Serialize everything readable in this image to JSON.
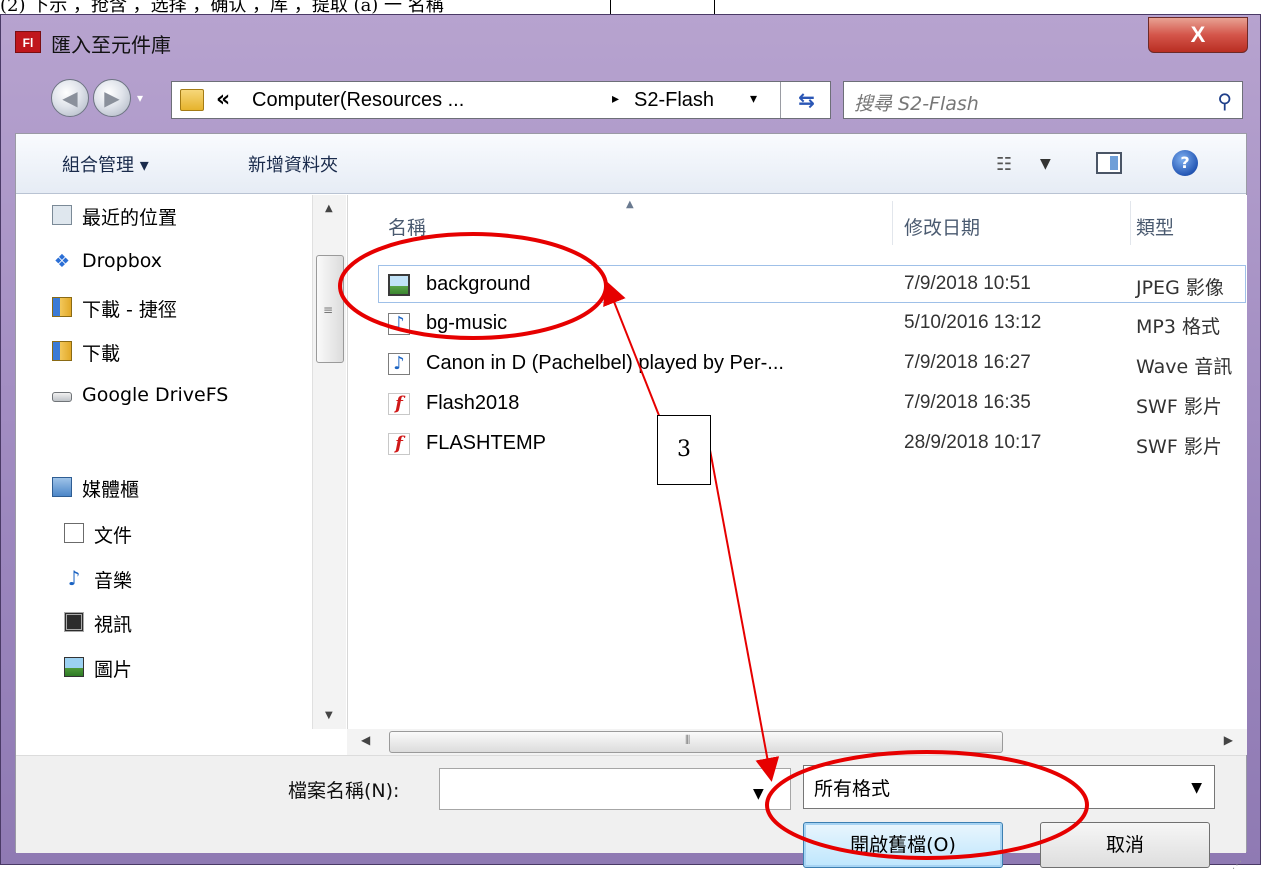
{
  "doc_strip": {
    "text": "(2) 下示 ，抢含 ，选择 ，确认 ，库 ，提取 (a) 一 名稱"
  },
  "window": {
    "title": "匯入至元件庫",
    "app_icon": "Fl",
    "close_label": "X"
  },
  "address_bar": {
    "segment1": "Computer(Resources ...",
    "segment2": "S2-Flash",
    "chevron": "«",
    "separator": "▸",
    "search_placeholder": "搜尋 S2-Flash"
  },
  "toolbar": {
    "organize_label": "組合管理 ▾",
    "new_folder_label": "新增資料夾"
  },
  "nav_pane": {
    "items": [
      {
        "label": "最近的位置",
        "icon": "recent-places-icon"
      },
      {
        "label": "Dropbox",
        "icon": "dropbox-icon"
      },
      {
        "label": "下載 - 捷徑",
        "icon": "folder-shortcut-icon"
      },
      {
        "label": "下載",
        "icon": "downloads-folder-icon"
      },
      {
        "label": "Google DriveFS",
        "icon": "drive-icon"
      },
      {
        "label": "媒體櫃",
        "icon": "library-icon"
      },
      {
        "label": "文件",
        "icon": "documents-icon"
      },
      {
        "label": "音樂",
        "icon": "music-icon"
      },
      {
        "label": "視訊",
        "icon": "video-icon"
      },
      {
        "label": "圖片",
        "icon": "pictures-icon"
      }
    ]
  },
  "file_list": {
    "columns": {
      "name": "名稱",
      "date": "修改日期",
      "type": "類型"
    },
    "rows": [
      {
        "name": "background",
        "date": "7/9/2018 10:51",
        "type": "JPEG 影像",
        "icon": "image-file-icon",
        "selected": true
      },
      {
        "name": "bg-music",
        "date": "5/10/2016 13:12",
        "type": "MP3 格式",
        "icon": "audio-file-icon",
        "selected": false
      },
      {
        "name": "Canon in D  (Pachelbel) played by Per-...",
        "date": "7/9/2018 16:27",
        "type": "Wave 音訊",
        "icon": "audio-file-icon",
        "selected": false
      },
      {
        "name": "Flash2018",
        "date": "7/9/2018 16:35",
        "type": "SWF 影片",
        "icon": "swf-file-icon",
        "selected": false
      },
      {
        "name": "FLASHTEMP",
        "date": "28/9/2018 10:17",
        "type": "SWF 影片",
        "icon": "swf-file-icon",
        "selected": false
      }
    ]
  },
  "bottom": {
    "filename_label": "檔案名稱(N):",
    "filename_value": "",
    "filetype_value": "所有格式",
    "open_button": "開啟舊檔(O)",
    "cancel_button": "取消"
  },
  "annotation": {
    "callout_number": "3",
    "color": "#e60000"
  }
}
